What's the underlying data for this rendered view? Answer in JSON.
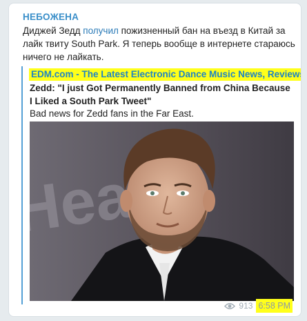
{
  "post": {
    "channel_name": "НЕБОЖЕНА",
    "text_before_link": "Диджей Зедд ",
    "link_text": "получил",
    "text_after_link": " пожизненный бан на въезд в Китай за лайк твиту South Park. Я теперь вообще в интернете стараюсь ничего не лайкать."
  },
  "preview": {
    "site_name": "EDM.com - The Latest Electronic Dance Music News, Reviews ...",
    "title": "Zedd: \"I just Got Permanently Banned from China Because I Liked a South Park Tweet\"",
    "description": "Bad news for Zedd fans in the Far East.",
    "backdrop_text": "Hear",
    "accent_color": "#54a0d6"
  },
  "meta": {
    "views": "913",
    "time": "6:58 PM",
    "highlight_color": "#ffff1a"
  }
}
